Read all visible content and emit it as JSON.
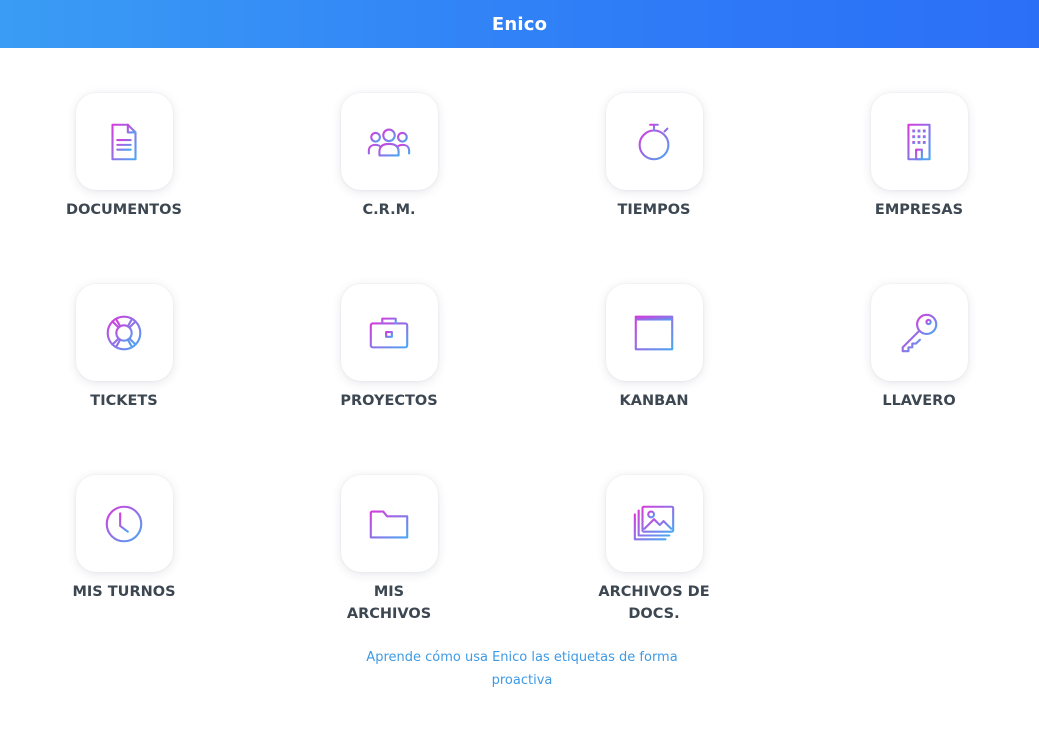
{
  "header": {
    "title": "Enico"
  },
  "apps": [
    {
      "label": "DOCUMENTOS",
      "icon": "document-icon"
    },
    {
      "label": "C.R.M.",
      "icon": "users-icon"
    },
    {
      "label": "TIEMPOS",
      "icon": "stopwatch-icon"
    },
    {
      "label": "EMPRESAS",
      "icon": "building-icon"
    },
    {
      "label": "TICKETS",
      "icon": "lifebuoy-icon"
    },
    {
      "label": "PROYECTOS",
      "icon": "briefcase-icon"
    },
    {
      "label": "KANBAN",
      "icon": "kanban-board-icon"
    },
    {
      "label": "LLAVERO",
      "icon": "key-icon"
    },
    {
      "label": "MIS TURNOS",
      "icon": "clock-icon"
    },
    {
      "label": "MIS ARCHIVOS",
      "icon": "folder-icon"
    },
    {
      "label": "ARCHIVOS DE DOCS.",
      "icon": "images-icon"
    }
  ],
  "footer": {
    "link_text": "Aprende cómo usa Enico las etiquetas de forma proactiva"
  },
  "colors": {
    "header_gradient_start": "#3a9cf4",
    "header_gradient_end": "#2b6ff7",
    "icon_gradient_start": "#d63bdc",
    "icon_gradient_end": "#4aa7f2",
    "label_text": "#3d4752",
    "link_text": "#3f9ae4"
  }
}
